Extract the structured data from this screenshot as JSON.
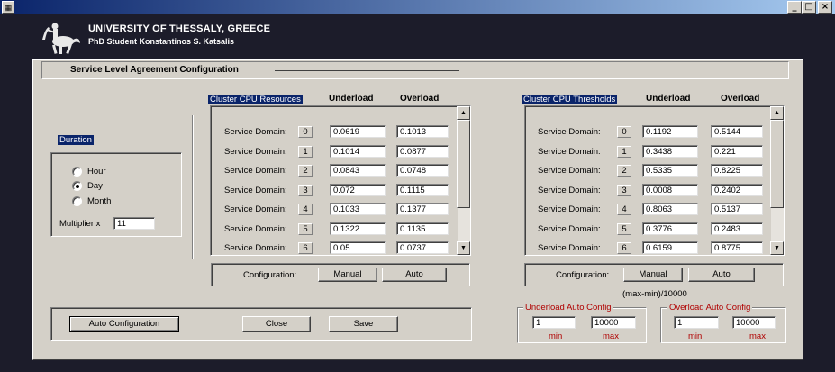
{
  "window": {
    "minimize": "_",
    "maximize": "□",
    "close": "×"
  },
  "header": {
    "university": "UNIVERSITY OF THESSALY, GREECE",
    "student": "PhD Student Konstantinos S. Katsalis"
  },
  "page_title": "Service Level Agreement Configuration",
  "duration": {
    "label": "Duration",
    "options": [
      "Hour",
      "Day",
      "Month"
    ],
    "selected": "Day",
    "multiplier_label": "Multiplier  x",
    "multiplier_value": "11"
  },
  "resources": {
    "title": "Cluster CPU Resources",
    "col_under": "Underload",
    "col_over": "Overload",
    "row_label": "Service Domain:",
    "rows": [
      {
        "idx": "0",
        "under": "0.0619",
        "over": "0.1013"
      },
      {
        "idx": "1",
        "under": "0.1014",
        "over": "0.0877"
      },
      {
        "idx": "2",
        "under": "0.0843",
        "over": "0.0748"
      },
      {
        "idx": "3",
        "under": "0.072",
        "over": "0.1115"
      },
      {
        "idx": "4",
        "under": "0.1033",
        "over": "0.1377"
      },
      {
        "idx": "5",
        "under": "0.1322",
        "over": "0.1135"
      },
      {
        "idx": "6",
        "under": "0.05",
        "over": "0.0737"
      }
    ],
    "config_label": "Configuration:",
    "manual": "Manual",
    "auto": "Auto"
  },
  "thresholds": {
    "title": "Cluster CPU Thresholds",
    "col_under": "Underload",
    "col_over": "Overload",
    "row_label": "Service Domain:",
    "rows": [
      {
        "idx": "0",
        "under": "0.1192",
        "over": "0.5144"
      },
      {
        "idx": "1",
        "under": "0.3438",
        "over": "0.221"
      },
      {
        "idx": "2",
        "under": "0.5335",
        "over": "0.8225"
      },
      {
        "idx": "3",
        "under": "0.0008",
        "over": "0.2402"
      },
      {
        "idx": "4",
        "under": "0.8063",
        "over": "0.5137"
      },
      {
        "idx": "5",
        "under": "0.3776",
        "over": "0.2483"
      },
      {
        "idx": "6",
        "under": "0.6159",
        "over": "0.8775"
      }
    ],
    "config_label": "Configuration:",
    "manual": "Manual",
    "auto": "Auto",
    "formula": "(max-min)/10000"
  },
  "underload_auto": {
    "title": "Underload Auto Config",
    "min": "1",
    "max": "10000",
    "min_label": "min",
    "max_label": "max"
  },
  "overload_auto": {
    "title": "Overload Auto Config",
    "min": "1",
    "max": "10000",
    "min_label": "min",
    "max_label": "max"
  },
  "bottom": {
    "auto_config": "Auto Configuration",
    "close": "Close",
    "save": "Save"
  },
  "scroll_up": "▲",
  "scroll_down": "▼"
}
